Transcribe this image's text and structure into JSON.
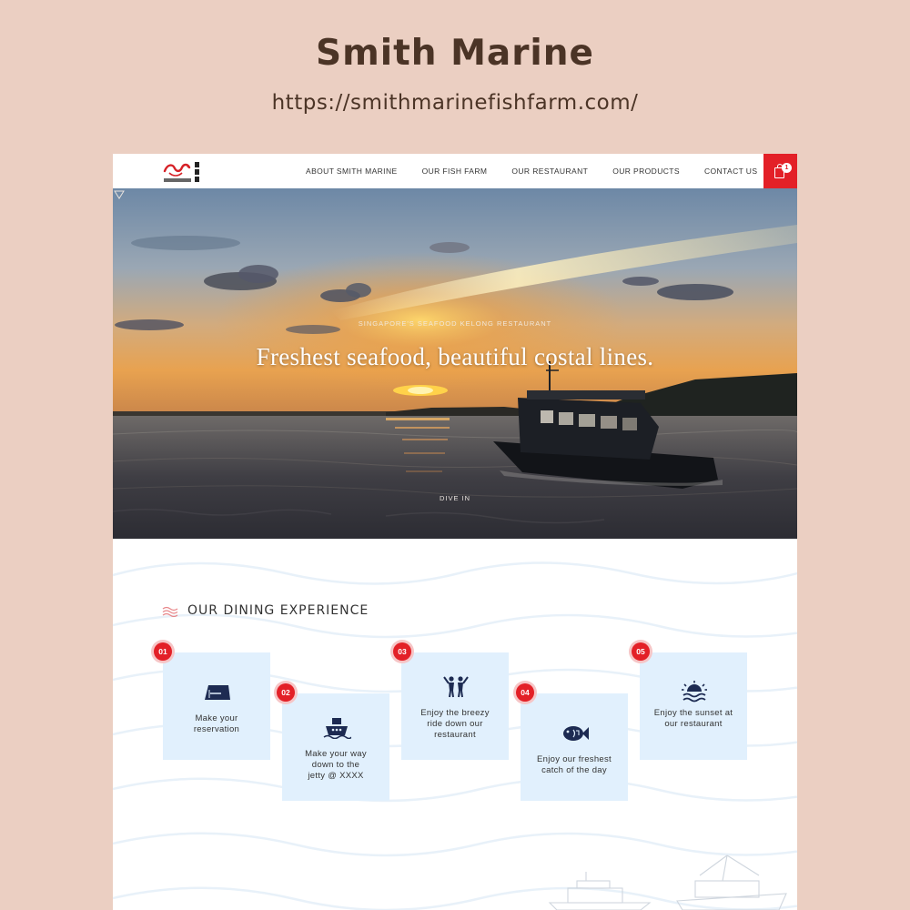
{
  "showcase": {
    "title": "Smith Marine",
    "url": "https://smithmarinefishfarm.com/"
  },
  "nav": {
    "logo_icon": "smith-marine-dragon-logo",
    "links": [
      "ABOUT SMITH MARINE",
      "OUR FISH FARM",
      "OUR RESTAURANT",
      "OUR PRODUCTS",
      "CONTACT US"
    ],
    "cart_icon": "shopping-bag-icon",
    "cart_count": "1"
  },
  "hero": {
    "eyebrow": "SINGAPORE'S SEAFOOD KELONG RESTAURANT",
    "heading": "Freshest seafood, beautiful costal lines.",
    "dive_label": "DIVE IN",
    "dive_icon": "chevron-down-icon"
  },
  "dining": {
    "title": "OUR DINING EXPERIENCE",
    "title_icon": "waves-icon",
    "steps": [
      {
        "number": "01",
        "icon": "ticket-icon",
        "text": [
          "Make your",
          "reservation"
        ]
      },
      {
        "number": "02",
        "icon": "ship-icon",
        "text": [
          "Make your way",
          "down to the",
          "jetty @ XXXX"
        ]
      },
      {
        "number": "03",
        "icon": "people-cheering-icon",
        "text": [
          "Enjoy the breezy",
          "ride down our",
          "restaurant"
        ]
      },
      {
        "number": "04",
        "icon": "fish-icon",
        "text": [
          "Enjoy our freshest",
          "catch of the day"
        ]
      },
      {
        "number": "05",
        "icon": "sunset-icon",
        "text": [
          "Enjoy the sunset at",
          "our restaurant"
        ]
      }
    ]
  },
  "colors": {
    "page_background": "#ebcfc2",
    "title_text": "#4b3426",
    "accent_red": "#e32027",
    "card_blue": "#e1f0fd",
    "icon_navy": "#1d2b52"
  }
}
